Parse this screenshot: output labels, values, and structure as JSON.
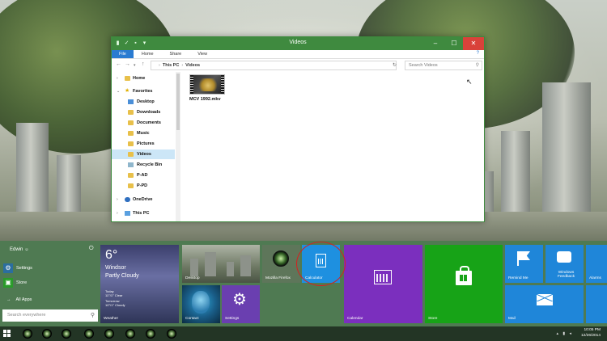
{
  "explorer": {
    "title": "Videos",
    "window_controls": {
      "minimize": "–",
      "maximize": "☐",
      "close": "✕"
    },
    "ribbon_tabs": [
      "File",
      "Home",
      "Share",
      "View"
    ],
    "address": {
      "root": "This PC",
      "current": "Videos"
    },
    "search_placeholder": "Search Videos",
    "nav": {
      "home": "Home",
      "favorites": "Favorites",
      "desktop": "Desktop",
      "downloads": "Downloads",
      "documents": "Documents",
      "music": "Music",
      "pictures": "Pictures",
      "videos": "Videos",
      "recycle_bin": "Recycle Bin",
      "p_ad": "P-AD",
      "p_pd": "P-PD",
      "onedrive": "OneDrive",
      "this_pc": "This PC"
    },
    "file": {
      "name": "MCV 1992.mkv",
      "icon": "video-thumbnail-icon"
    }
  },
  "start": {
    "user": "Edwin",
    "items": {
      "settings": "Settings",
      "store": "Store"
    },
    "all_apps": "All Apps",
    "search_placeholder": "Search everywhere",
    "tiles": {
      "weather": {
        "temp": "6°",
        "location": "Windsor",
        "condition": "Partly Cloudy",
        "today_label": "Today",
        "today_value": "11°/1° Clear",
        "tomorrow_label": "Tomorrow",
        "tomorrow_value": "10°/1° Cloudy",
        "label": "Weather"
      },
      "desktop": "Desktop",
      "contact": "Contact",
      "settings": "Settings",
      "firefox": "Mozilla Firefox",
      "calculator": "Calculator",
      "calendar": "Calendar",
      "store": "Store",
      "remind_me": "Remind Me",
      "windows_feedback": "Windows Feedback",
      "alarms": "Alarms",
      "mail": "Mail"
    }
  },
  "taskbar": {
    "time": "10:05 PM",
    "date": "12/26/2014",
    "pinned_apps": 8
  },
  "colors": {
    "explorer_accent": "#3f8a3f",
    "start_bg": "#4f7a52",
    "calculator_tile": "#1e90e0",
    "calendar_tile": "#7b2fbe",
    "store_tile": "#17a317",
    "highlight_ring": "#d62020"
  }
}
